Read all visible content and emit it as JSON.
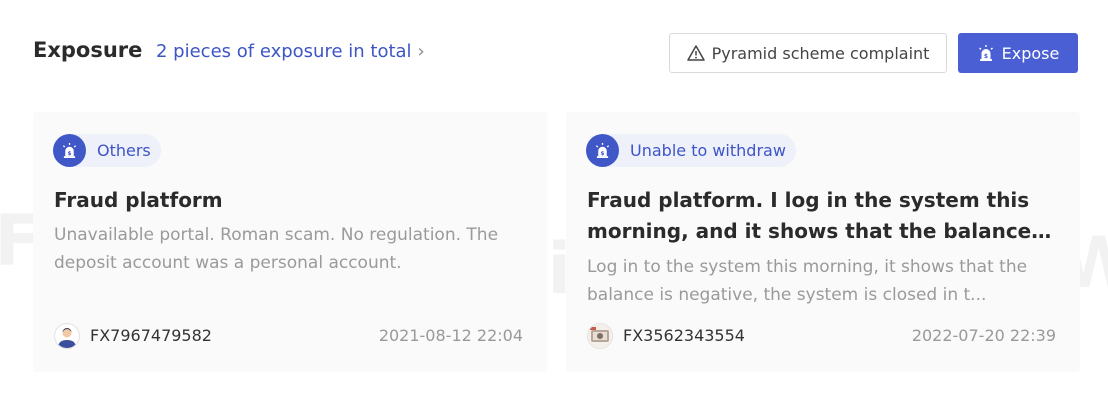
{
  "header": {
    "title": "Exposure",
    "total_link": "2 pieces of exposure in total",
    "complaint_button": "Pyramid scheme complaint",
    "expose_button": "Expose"
  },
  "watermark": {
    "text_left": "FX",
    "text_mid": "WikiFX",
    "text_right": "W"
  },
  "cards": [
    {
      "tag": "Others",
      "title": "Fraud platform",
      "description": "Unavailable portal. Roman scam. No regulation. The deposit account was a personal account.",
      "user": "FX7967479582",
      "date": "2021-08-12 22:04"
    },
    {
      "tag": "Unable to withdraw",
      "title": "Fraud platform. I log in the system this morning, and it shows that the balance ...",
      "description": "Log in to the system this morning, it shows that the balance is negative, the system is closed in t...",
      "user": "FX3562343554",
      "date": "2022-07-20 22:39"
    }
  ],
  "colors": {
    "accent": "#4a5fd4",
    "link": "#3d55c6",
    "tag_bg": "#eef0fa"
  }
}
